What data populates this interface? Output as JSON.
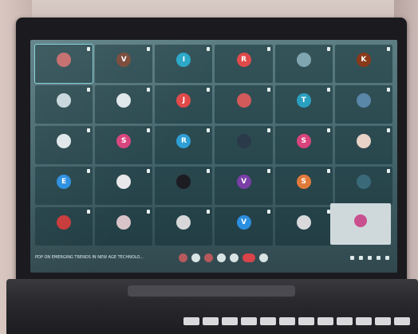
{
  "participants": [
    {
      "name": "",
      "initial": "",
      "color": "#c46b6b"
    },
    {
      "name": "",
      "initial": "V",
      "color": "#7a4a3a"
    },
    {
      "name": "",
      "initial": "I",
      "color": "#2aa7c8"
    },
    {
      "name": "",
      "initial": "R",
      "color": "#e04a4a"
    },
    {
      "name": "",
      "initial": "",
      "color": "#7fa6b0"
    },
    {
      "name": "",
      "initial": "K",
      "color": "#8a3a1a"
    },
    {
      "name": "",
      "initial": "",
      "color": "#c7d6dc"
    },
    {
      "name": "",
      "initial": "",
      "color": "#dfe7ea"
    },
    {
      "name": "",
      "initial": "J",
      "color": "#e14949"
    },
    {
      "name": "",
      "initial": "",
      "color": "#d25a5a"
    },
    {
      "name": "",
      "initial": "T",
      "color": "#2aa0c0"
    },
    {
      "name": "",
      "initial": "",
      "color": "#5a86a8"
    },
    {
      "name": "",
      "initial": "",
      "color": "#e0e7ea"
    },
    {
      "name": "",
      "initial": "S",
      "color": "#d8437c"
    },
    {
      "name": "",
      "initial": "R",
      "color": "#2e9fd4"
    },
    {
      "name": "",
      "initial": "",
      "color": "#2a3a4a"
    },
    {
      "name": "",
      "initial": "S",
      "color": "#d8437c"
    },
    {
      "name": "",
      "initial": "",
      "color": "#e9d2c7"
    },
    {
      "name": "",
      "initial": "E",
      "color": "#2b8fe0"
    },
    {
      "name": "",
      "initial": "",
      "color": "#e8e8ea"
    },
    {
      "name": "",
      "initial": "",
      "color": "#1c1c22"
    },
    {
      "name": "",
      "initial": "V",
      "color": "#7a3fa6"
    },
    {
      "name": "",
      "initial": "S",
      "color": "#e07a3a"
    },
    {
      "name": "",
      "initial": "",
      "color": "#3a6a7a"
    },
    {
      "name": "",
      "initial": "",
      "color": "#c83a3a"
    },
    {
      "name": "",
      "initial": "",
      "color": "#d8c4c8"
    },
    {
      "name": "",
      "initial": "",
      "color": "#d7d7da"
    },
    {
      "name": "",
      "initial": "V",
      "color": "#2b8fe0"
    },
    {
      "name": "",
      "initial": "",
      "color": "#d9d9dc"
    },
    {
      "name": "",
      "initial": "",
      "color": "#cfd9db"
    }
  ],
  "caption": "PDP ON EMERGING TRENDS IN NEW AGE TECHNOLO...",
  "self_tile": {
    "initial": "",
    "color": "#c9508e"
  }
}
